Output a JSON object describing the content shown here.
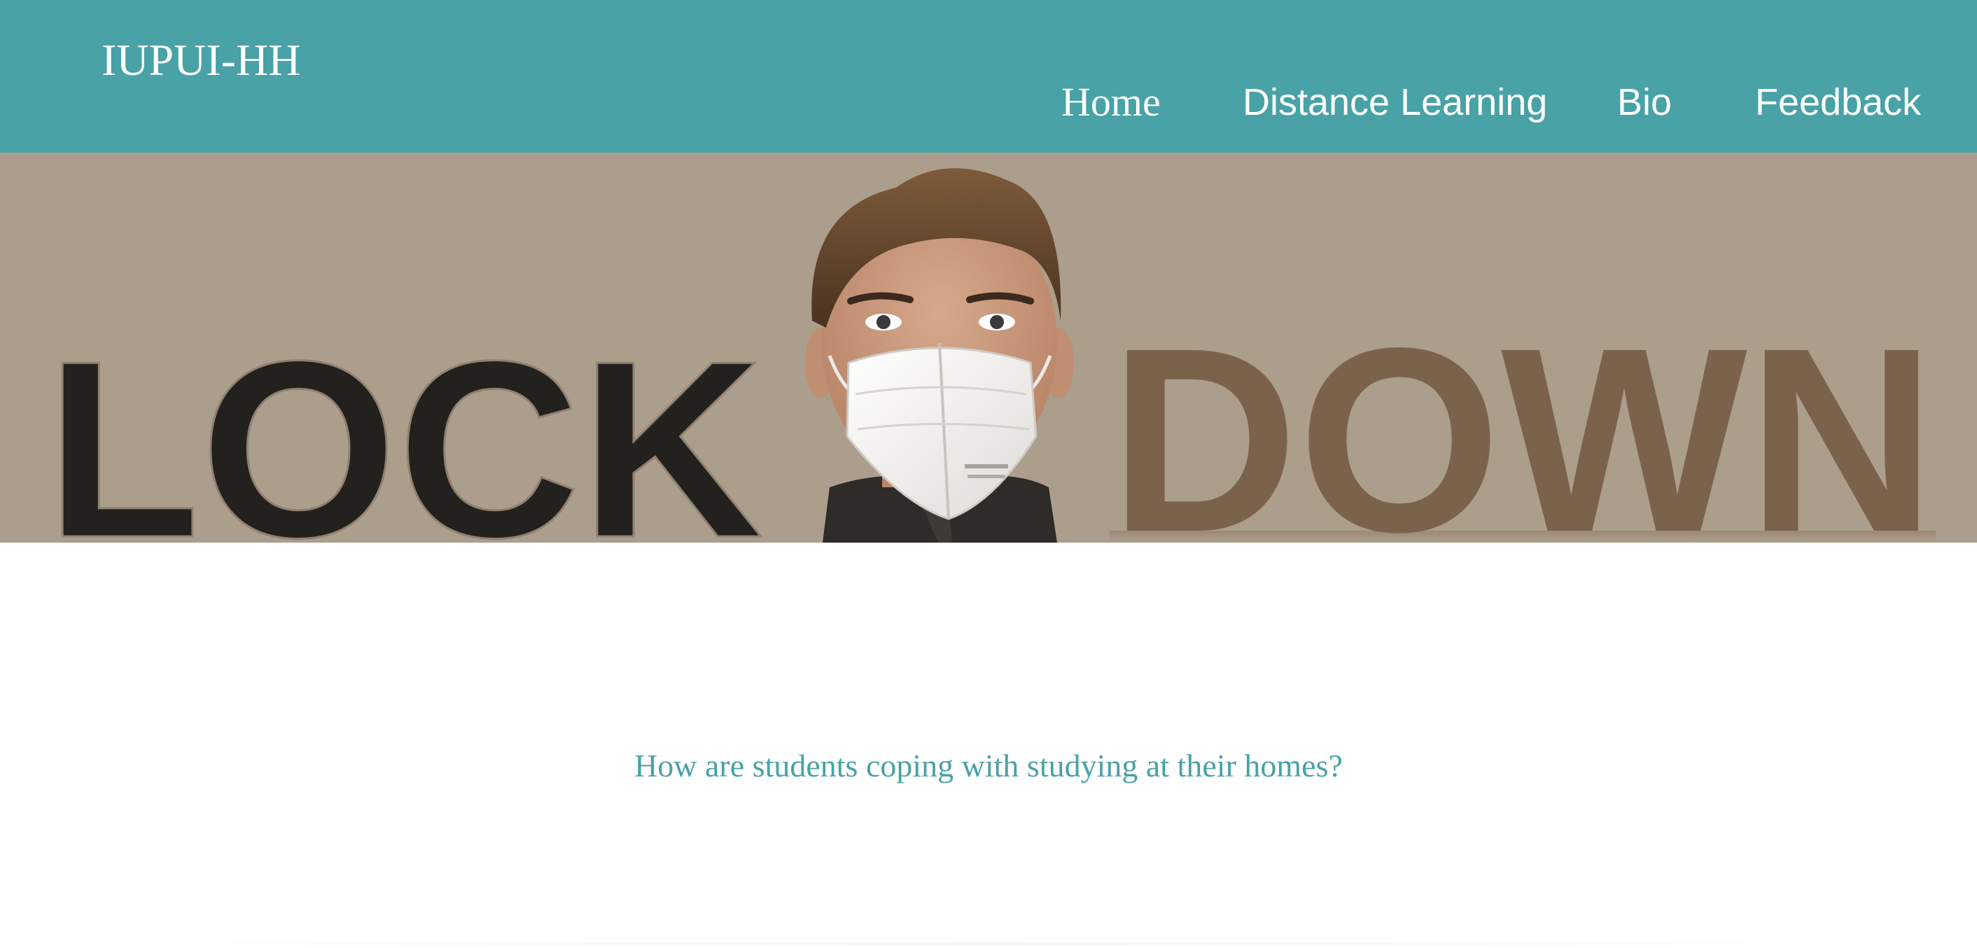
{
  "header": {
    "site_title": "IUPUI-HH",
    "nav": {
      "home": "Home",
      "distance_learning": "Distance Learning",
      "bio": "Bio",
      "feedback": "Feedback"
    }
  },
  "hero": {
    "word_left": "LOCK",
    "word_right": "DOWN"
  },
  "main": {
    "subtitle": "How are students coping with studying at their homes?"
  },
  "colors": {
    "header_background": "#48a2a6",
    "header_text": "#ffffff",
    "hero_background": "#ac9e8c",
    "lock_text": "#23211d",
    "down_text": "#7b634b",
    "subtitle_text": "#48a2a6",
    "page_background": "#ffffff"
  }
}
